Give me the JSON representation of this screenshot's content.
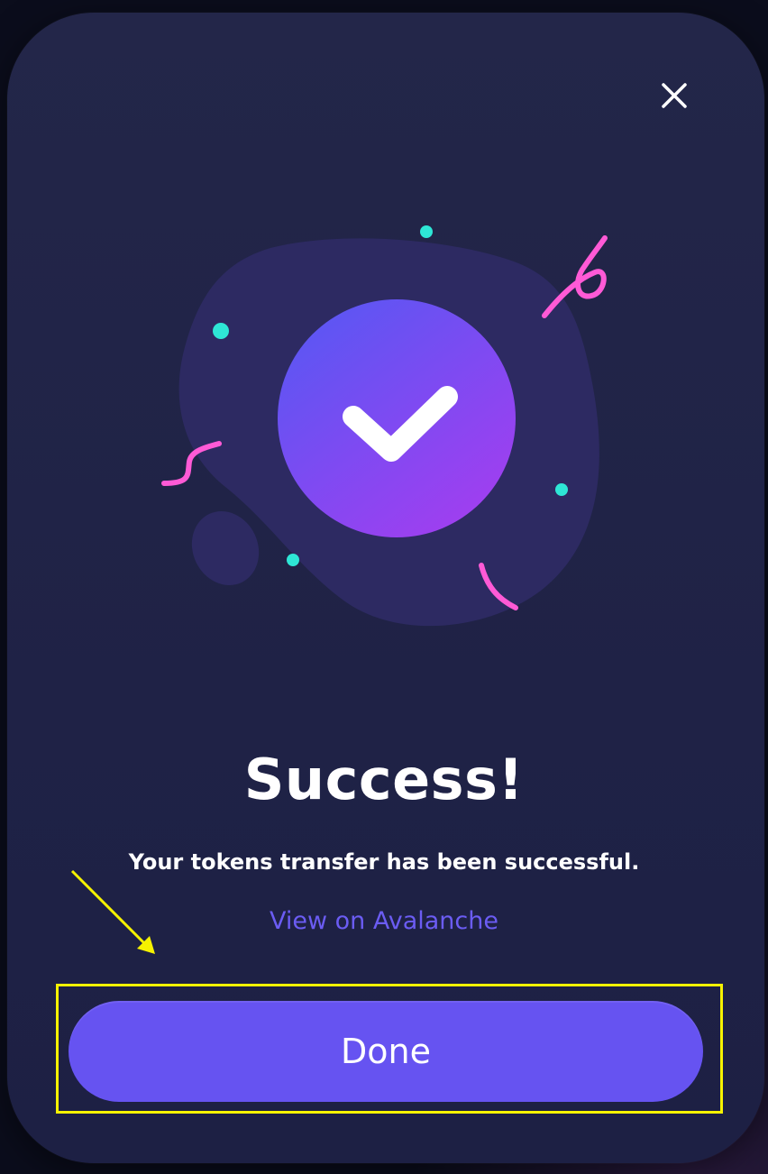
{
  "modal": {
    "close_icon": "close-icon",
    "illustration_icon": "checkmark-icon",
    "title": "Success!",
    "message": "Your tokens transfer has been successful.",
    "link_label": "View on Avalanche",
    "done_label": "Done"
  },
  "colors": {
    "accent": "#6653f1",
    "link": "#6b5cf3",
    "confetti_cyan": "#2ee6d6",
    "confetti_pink": "#ff5ad6",
    "highlight": "#f6f200"
  }
}
